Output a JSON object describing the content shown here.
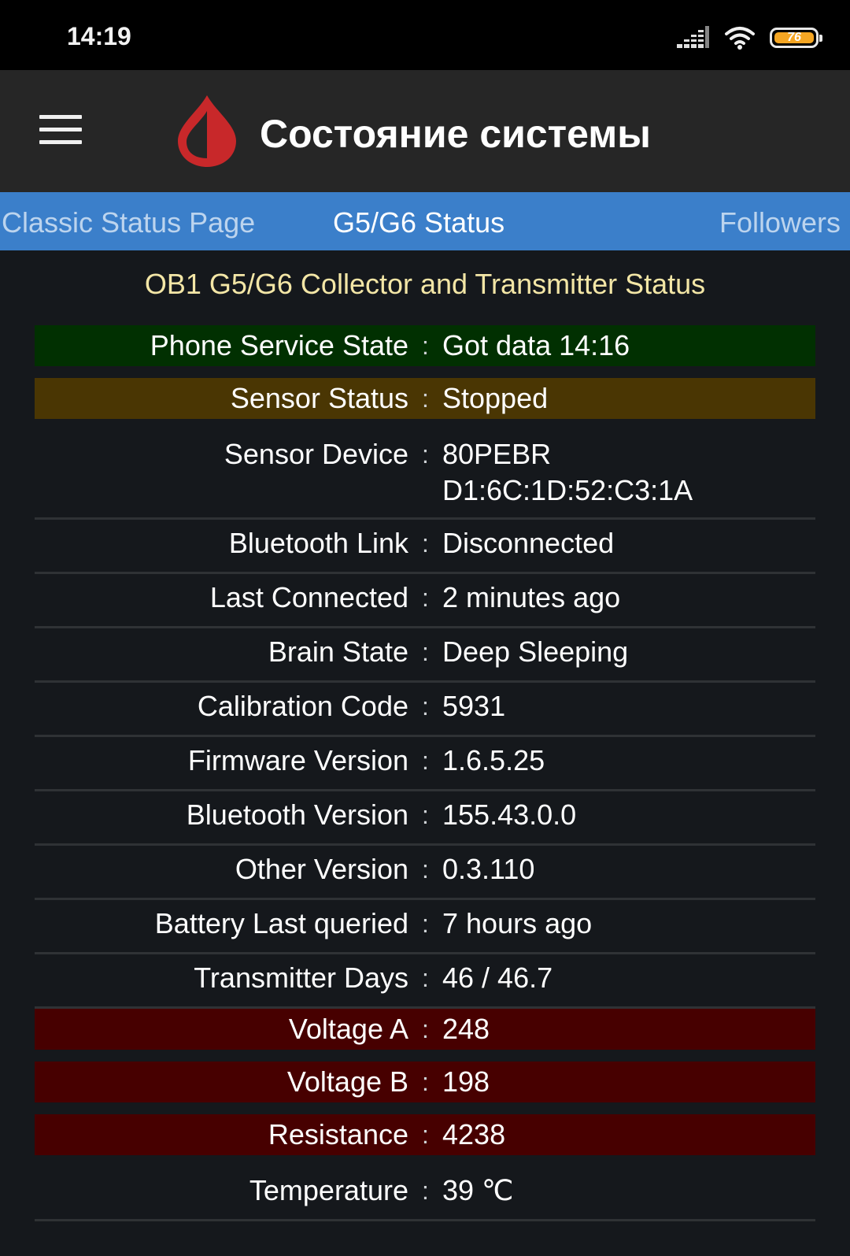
{
  "status_bar": {
    "time": "14:19",
    "battery_level": "76"
  },
  "app_bar": {
    "title": "Состояние системы"
  },
  "tabs": [
    {
      "label": "Classic Status Page",
      "active": false
    },
    {
      "label": "G5/G6 Status",
      "active": true
    },
    {
      "label": "Followers",
      "active": false
    }
  ],
  "section_title": "OB1 G5/G6 Collector and Transmitter Status",
  "separator": ":",
  "rows": [
    {
      "label": "Phone Service State",
      "value": "Got data 14:16",
      "highlight": "#013001"
    },
    {
      "label": "Sensor Status",
      "value": "Stopped",
      "highlight": "#4a3603"
    },
    {
      "label": "Sensor Device",
      "value": "80PEBR",
      "value2": "D1:6C:1D:52:C3:1A"
    },
    {
      "label": "Bluetooth Link",
      "value": "Disconnected"
    },
    {
      "label": "Last Connected",
      "value": "2 minutes ago"
    },
    {
      "label": "Brain State",
      "value": "Deep Sleeping"
    },
    {
      "label": "Calibration Code",
      "value": "5931"
    },
    {
      "label": "Firmware Version",
      "value": "1.6.5.25"
    },
    {
      "label": "Bluetooth Version",
      "value": "155.43.0.0"
    },
    {
      "label": "Other Version",
      "value": "0.3.110"
    },
    {
      "label": "Battery Last queried",
      "value": "7 hours ago"
    },
    {
      "label": "Transmitter Days",
      "value": "46 / 46.7"
    },
    {
      "label": "Voltage A",
      "value": "248",
      "highlight": "#470000"
    },
    {
      "label": "Voltage B",
      "value": "198",
      "highlight": "#470000"
    },
    {
      "label": "Resistance",
      "value": "4238",
      "highlight": "#470000"
    },
    {
      "label": "Temperature",
      "value": "39 ℃"
    }
  ],
  "colors": {
    "background": "#15181c",
    "app_bar": "#262626",
    "tab_bar": "#3b7fca",
    "section_title": "#f3e6a6",
    "logo_red": "#c8282a"
  }
}
